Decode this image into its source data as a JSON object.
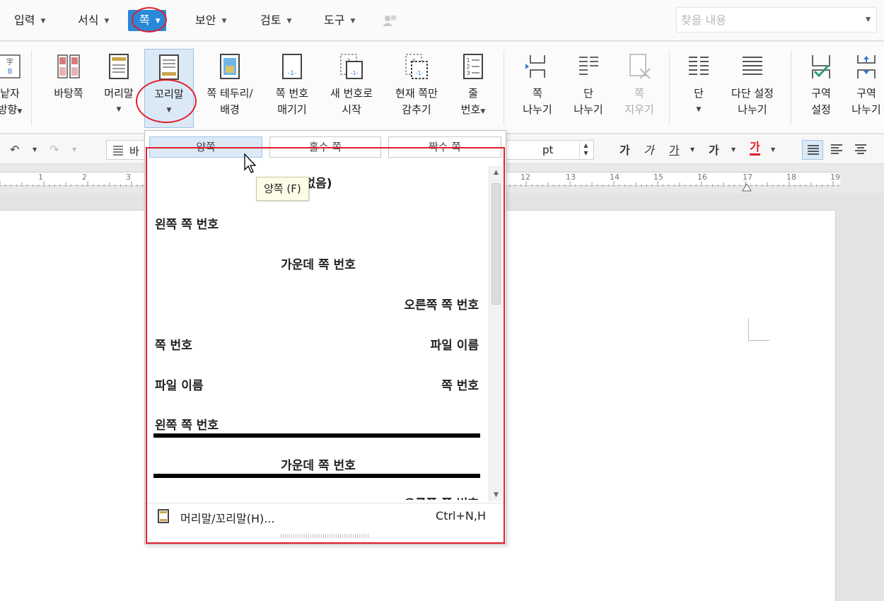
{
  "menubar": {
    "items": [
      {
        "label": "입력"
      },
      {
        "label": "서식"
      },
      {
        "label": "쪽"
      },
      {
        "label": "보안"
      },
      {
        "label": "검토"
      },
      {
        "label": "도구"
      }
    ],
    "search_placeholder": "찾을 내용",
    "active_color": "#2a88d8"
  },
  "ribbon": {
    "partial_left": {
      "line1": "낱자",
      "line2": "방향"
    },
    "buttons": [
      {
        "line1": "바탕쪽",
        "line2": ""
      },
      {
        "line1": "머리말",
        "line2": ""
      },
      {
        "line1": "꼬리말",
        "line2": ""
      },
      {
        "line1": "쪽 테두리/",
        "line2": "배경"
      },
      {
        "line1": "쪽 번호",
        "line2": "매기기"
      },
      {
        "line1": "새 번호로",
        "line2": "시작"
      },
      {
        "line1": "현재 쪽만",
        "line2": "감추기"
      },
      {
        "line1": "줄",
        "line2": "번호"
      },
      {
        "line1": "쪽",
        "line2": "나누기"
      },
      {
        "line1": "단",
        "line2": "나누기"
      },
      {
        "line1": "쪽",
        "line2": "지우기"
      },
      {
        "line1": "단",
        "line2": ""
      },
      {
        "line1": "다단 설정",
        "line2": "나누기"
      },
      {
        "line1": "구역",
        "line2": "설정"
      },
      {
        "line1": "구역",
        "line2": "나누기"
      }
    ]
  },
  "format_toolbar": {
    "style_text": "바",
    "size_unit": "pt",
    "bold": "가",
    "italic": "가",
    "underline": "가",
    "strike": "가",
    "color": "가"
  },
  "ruler": {
    "numbers": [
      "1",
      "2",
      "3",
      "12",
      "13",
      "14",
      "15",
      "16",
      "17",
      "18",
      "19"
    ]
  },
  "gallery": {
    "tabs": [
      {
        "label": "양쪽"
      },
      {
        "label": "홀수 쪽"
      },
      {
        "label": "짝수 쪽"
      }
    ],
    "entries": {
      "none_label": "없음)",
      "left_page_no": "왼쪽 쪽 번호",
      "center_page_no": "가운데 쪽 번호",
      "right_page_no": "오른쪽 쪽 번호",
      "row4_left": "쪽 번호",
      "row4_right": "파일 이름",
      "row5_left": "파일 이름",
      "row5_right": "쪽 번호",
      "lined_left": "왼쪽 쪽 번호",
      "lined_center": "가운데 쪽 번호",
      "lined_right": "오른쪽 쪽 번호"
    },
    "footer": {
      "label": "머리말/꼬리말(H)...",
      "shortcut": "Ctrl+N,H"
    }
  },
  "tooltip": {
    "text": "양쪽 (F)"
  },
  "highlight_color": "#e31e2b"
}
